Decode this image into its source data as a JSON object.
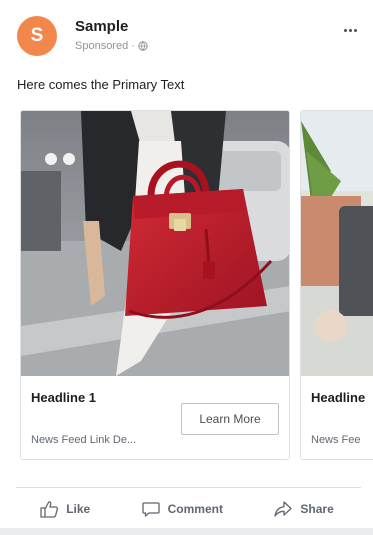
{
  "post": {
    "page_name": "Sample",
    "avatar_letter": "S",
    "sponsored_label": "Sponsored",
    "separator": "·",
    "primary_text": "Here comes the Primary Text"
  },
  "carousel": {
    "cards": [
      {
        "headline": "Headline 1",
        "link_description": "News Feed Link De...",
        "cta_label": "Learn More"
      },
      {
        "headline": "Headline",
        "link_description": "News Fee"
      }
    ]
  },
  "actions": {
    "like_label": "Like",
    "comment_label": "Comment",
    "share_label": "Share"
  },
  "colors": {
    "avatar": "#f2874b",
    "text_primary": "#1c1e21",
    "text_secondary": "#606770",
    "bag": "#c8202f"
  }
}
